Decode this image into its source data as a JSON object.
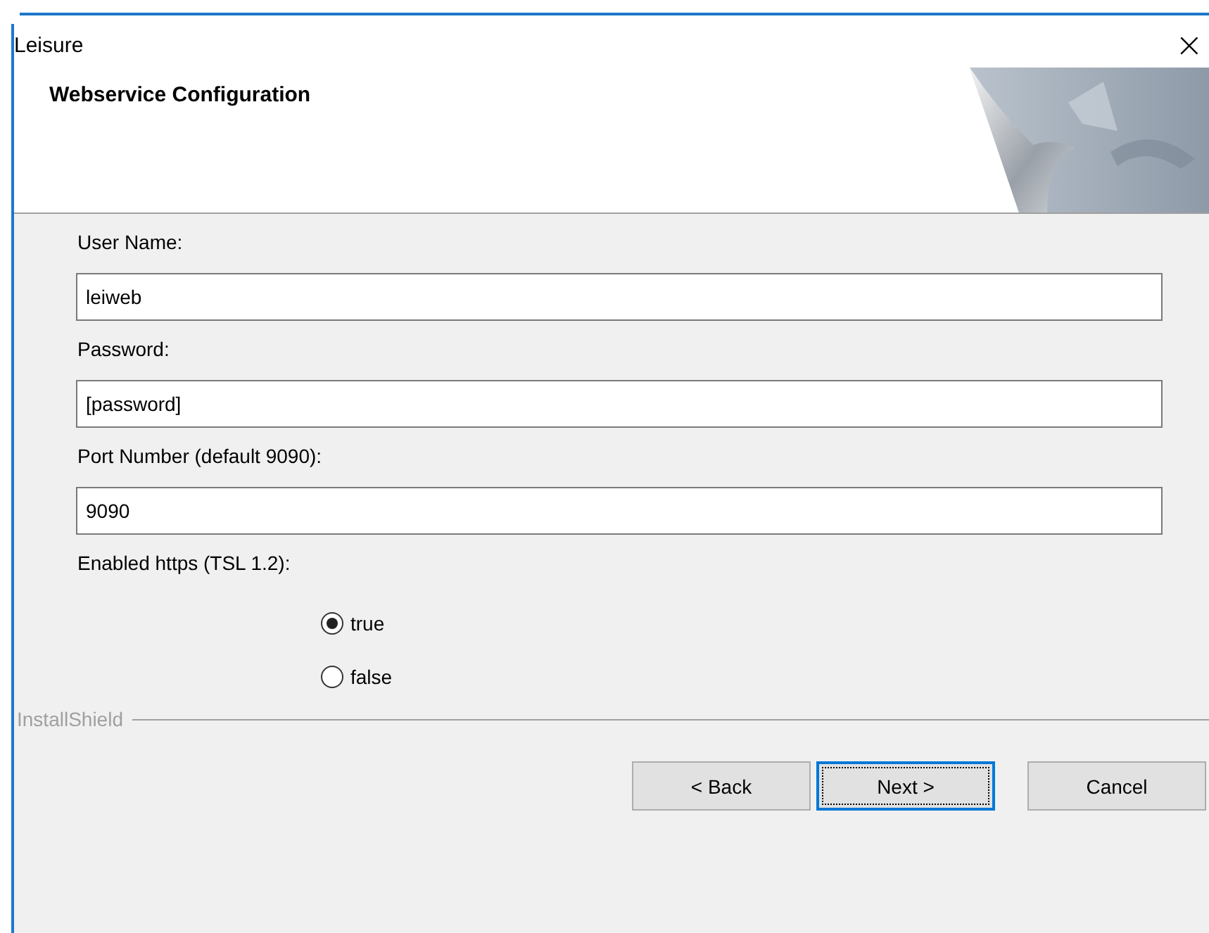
{
  "window": {
    "title": "Leisure",
    "close": "×"
  },
  "header": {
    "title": "Webservice Configuration"
  },
  "fields": [
    {
      "label": "User Name:",
      "value": "leiweb"
    },
    {
      "label": "Password:",
      "value": "[password]"
    },
    {
      "label": "Port Number (default 9090):",
      "value": "9090"
    }
  ],
  "https": {
    "label": "Enabled https (TSL 1.2):",
    "options": [
      {
        "label": "true",
        "selected": true
      },
      {
        "label": "false",
        "selected": false
      }
    ]
  },
  "brand": "InstallShield",
  "buttons": [
    {
      "label": "< Back",
      "focused": false
    },
    {
      "label": "Next >",
      "focused": true
    },
    {
      "label": "Cancel",
      "focused": false
    }
  ]
}
